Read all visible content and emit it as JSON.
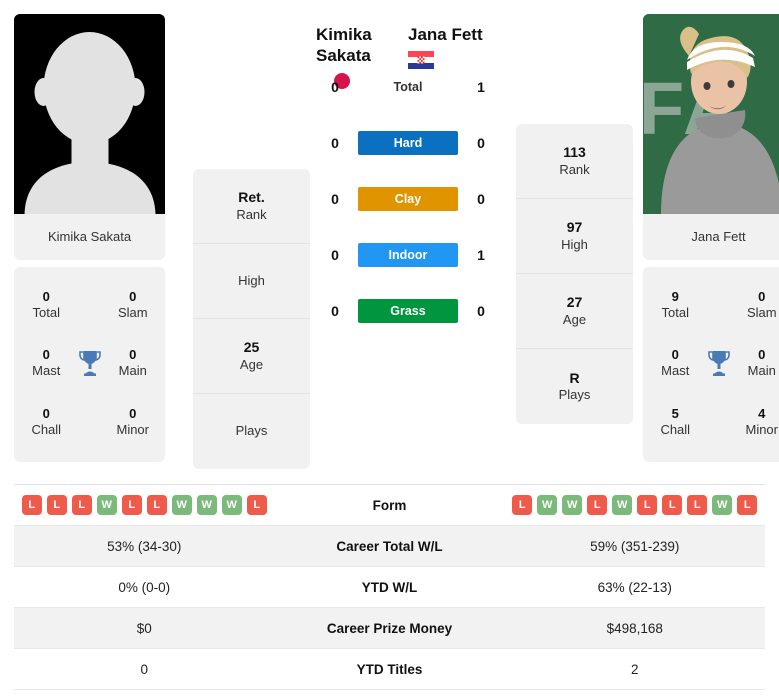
{
  "players": {
    "left": {
      "name_line1": "Kimika",
      "name_line2": "Sakata",
      "full_name": "Kimika Sakata",
      "flag": "japan-flag",
      "photo": "placeholder-avatar",
      "rank": "Ret.",
      "rank_label": "Rank",
      "high": "",
      "high_label": "High",
      "age": "25",
      "age_label": "Age",
      "plays": "",
      "plays_label": "Plays",
      "titles": {
        "total": "0",
        "total_label": "Total",
        "slam": "0",
        "slam_label": "Slam",
        "mast": "0",
        "mast_label": "Mast",
        "main": "0",
        "main_label": "Main",
        "chall": "0",
        "chall_label": "Chall",
        "minor": "0",
        "minor_label": "Minor"
      }
    },
    "right": {
      "name_line1": "Jana Fett",
      "name_line2": "",
      "full_name": "Jana Fett",
      "flag": "croatia-flag",
      "photo": "player-photo",
      "rank": "113",
      "rank_label": "Rank",
      "high": "97",
      "high_label": "High",
      "age": "27",
      "age_label": "Age",
      "plays": "R",
      "plays_label": "Plays",
      "titles": {
        "total": "9",
        "total_label": "Total",
        "slam": "0",
        "slam_label": "Slam",
        "mast": "0",
        "mast_label": "Mast",
        "main": "0",
        "main_label": "Main",
        "chall": "5",
        "chall_label": "Chall",
        "minor": "4",
        "minor_label": "Minor"
      }
    }
  },
  "h2h": {
    "rows": [
      {
        "label": "Total",
        "left": "0",
        "right": "1",
        "color": ""
      },
      {
        "label": "Hard",
        "left": "0",
        "right": "0",
        "color": "#0b70c0"
      },
      {
        "label": "Clay",
        "left": "0",
        "right": "0",
        "color": "#e09400"
      },
      {
        "label": "Indoor",
        "left": "0",
        "right": "1",
        "color": "#2196f3"
      },
      {
        "label": "Grass",
        "left": "0",
        "right": "0",
        "color": "#009640"
      }
    ]
  },
  "form": {
    "label": "Form",
    "left": [
      "L",
      "L",
      "L",
      "W",
      "L",
      "L",
      "W",
      "W",
      "W",
      "L"
    ],
    "right": [
      "L",
      "W",
      "W",
      "L",
      "W",
      "L",
      "L",
      "L",
      "W",
      "L"
    ]
  },
  "stats_rows": [
    {
      "label": "Career Total W/L",
      "left": "53% (34-30)",
      "right": "59% (351-239)"
    },
    {
      "label": "YTD W/L",
      "left": "0% (0-0)",
      "right": "63% (22-13)"
    },
    {
      "label": "Career Prize Money",
      "left": "$0",
      "right": "$498,168"
    },
    {
      "label": "YTD Titles",
      "left": "0",
      "right": "2"
    }
  ],
  "colors": {
    "win": "#7cba7c",
    "loss": "#ee5b4a",
    "card_bg": "#f1f1f1",
    "row_shade": "#f2f2f2"
  }
}
